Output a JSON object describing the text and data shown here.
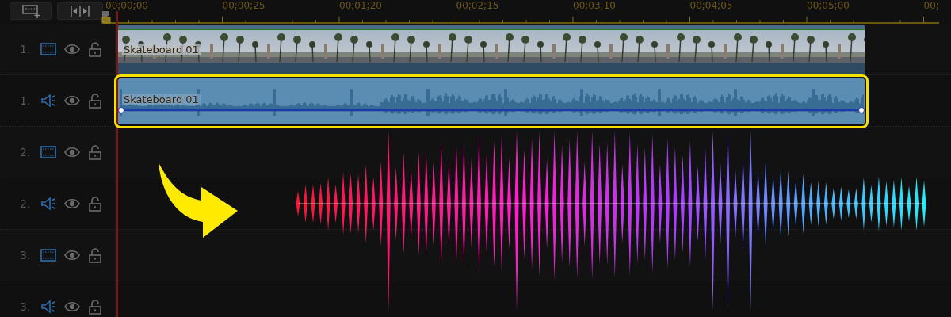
{
  "toolbar": {
    "buttons": [
      {
        "kind": "add-track"
      },
      {
        "kind": "fit"
      }
    ]
  },
  "ruler": {
    "labels": [
      "00;00;00",
      "00;00;25",
      "00;01;20",
      "00;02;15",
      "00;03;10",
      "00;04;05",
      "00;05;00",
      "00;"
    ]
  },
  "tracks": [
    {
      "number": "1.",
      "kind": "video",
      "clips": [
        {
          "label": "Skateboard 01",
          "selected": false
        }
      ]
    },
    {
      "number": "1.",
      "kind": "audio",
      "clips": [
        {
          "label": "Skateboard 01",
          "selected": true
        }
      ]
    },
    {
      "number": "2.",
      "kind": "video"
    },
    {
      "number": "2.",
      "kind": "audio"
    },
    {
      "number": "3.",
      "kind": "video"
    },
    {
      "number": "3.",
      "kind": "audio"
    }
  ]
}
